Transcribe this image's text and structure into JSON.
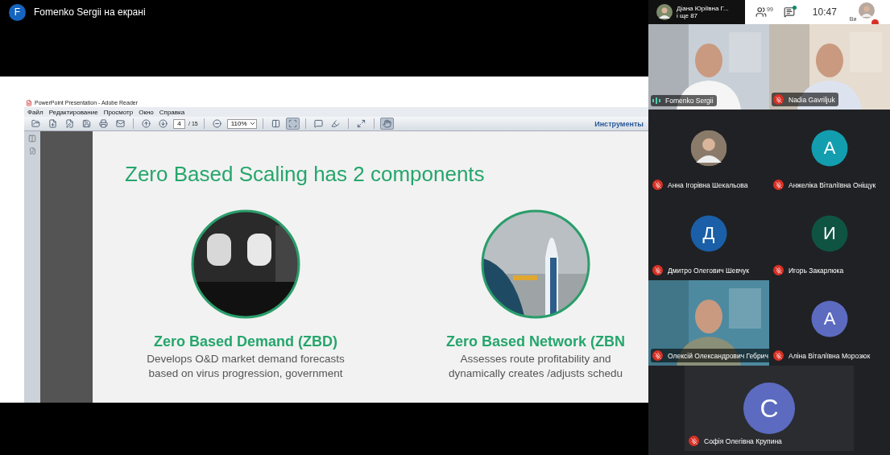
{
  "top_bar": {
    "presenter_initial": "F",
    "presenter_label": "Fomenko Sergii на екрані"
  },
  "header": {
    "chip_name": "Діана Юріївна Г...",
    "chip_more": "і ще 87",
    "people_count": "99",
    "chat_unread": true,
    "time": "10:47",
    "self_label": "Ви",
    "self_muted": true
  },
  "reader": {
    "title": "PowerPoint Presentation - Adobe Reader",
    "menu": [
      "Файл",
      "Редактирование",
      "Просмотр",
      "Окно",
      "Справка"
    ],
    "page": "4",
    "pages": "/ 15",
    "zoom": "110%",
    "tools_label": "Инструменты",
    "fit_page_on": true,
    "hand_tool_on": true
  },
  "slide": {
    "title": "Zero Based Scaling has 2 components",
    "components": [
      {
        "heading": "Zero Based Demand (ZBD)",
        "lines": [
          "Develops O&D market demand forecasts",
          "based on virus progression, government"
        ]
      },
      {
        "heading": "Zero Based Network (ZBN",
        "lines": [
          "Assesses route profitability and",
          "dynamically creates /adjusts schedu"
        ]
      }
    ]
  },
  "participants": [
    {
      "kind": "video",
      "name": "Fomenko Sergii",
      "muted": false
    },
    {
      "kind": "video",
      "name": "Nadia Gavriljuk",
      "muted": true
    },
    {
      "name": "Анна Ігорівна Шекальова",
      "muted": true
    },
    {
      "kind": "letter",
      "initial": "А",
      "color": "#129eaf",
      "name": "Анжеліка Віталіївна Оніщук",
      "muted": true
    },
    {
      "kind": "letter",
      "initial": "Д",
      "color": "#1a5fa8",
      "name": "Дмитро Олегович Шевчук",
      "muted": true
    },
    {
      "kind": "letter",
      "initial": "И",
      "color": "#0f5443",
      "name": "Игорь Закарлюка",
      "muted": true
    },
    {
      "kind": "video",
      "name": "Олексій Олександрович Гебрич",
      "muted": true
    },
    {
      "kind": "letter",
      "initial": "А",
      "color": "#5c6bc0",
      "name": "Аліна Віталіївна Морозюк",
      "muted": true
    },
    {
      "kind": "letter",
      "initial": "С",
      "color": "#5c6bc0",
      "name": "Софія Олегівна Крупина",
      "muted": true
    }
  ]
}
